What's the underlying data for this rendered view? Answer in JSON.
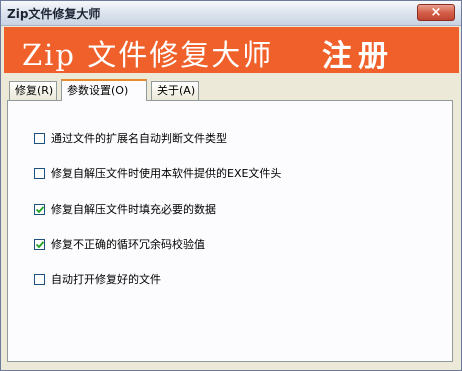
{
  "window": {
    "title": "Zip文件修复大师",
    "close_label": "×"
  },
  "banner": {
    "app_name": "Zip 文件修复大师",
    "register_label": "注册",
    "color": "#f0602a"
  },
  "tabs": [
    {
      "label": "修复(R)",
      "active": false
    },
    {
      "label": "参数设置(O)",
      "active": true
    },
    {
      "label": "关于(A)",
      "active": false
    }
  ],
  "options": [
    {
      "label": "通过文件的扩展名自动判断文件类型",
      "checked": false
    },
    {
      "label": "修复自解压文件时使用本软件提供的EXE文件头",
      "checked": false
    },
    {
      "label": "修复自解压文件时填充必要的数据",
      "checked": true
    },
    {
      "label": "修复不正确的循环冗余码校验值",
      "checked": true
    },
    {
      "label": "自动打开修复好的文件",
      "checked": false
    }
  ]
}
